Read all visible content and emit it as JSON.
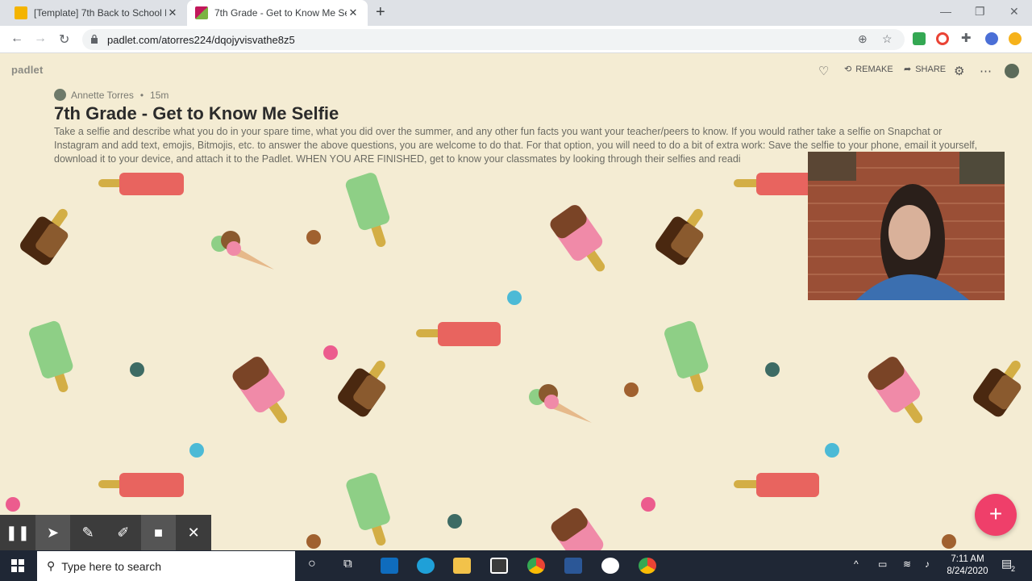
{
  "browser": {
    "tabs": [
      {
        "title": "[Template] 7th Back to School Le",
        "active": false,
        "favicon_color": "#f4b400"
      },
      {
        "title": "7th Grade - Get to Know Me Selfi",
        "active": true,
        "favicon_color": "#c2185b"
      }
    ],
    "url": "padlet.com/atorres224/dqojyvisvathe8z5"
  },
  "padlet": {
    "logo": "padlet",
    "remake_label": "REMAKE",
    "share_label": "SHARE",
    "author": "Annette Torres",
    "time_ago": "15m",
    "title": "7th Grade - Get to Know Me Selfie",
    "description": "Take a selfie and describe what you do in your spare time, what you did over the summer, and any other fun facts you want your teacher/peers to know. If you would rather take a selfie on Snapchat or Instagram and add text, emojis, Bitmojis, etc. to answer the above questions, you are welcome to do that. For that option, you will need to do a bit of extra work: Save the selfie to your phone, email it yourself, download it to your device, and attach it to the Padlet. WHEN YOU ARE FINISHED, get to know your classmates by looking through their selfies and readi",
    "fab_label": "+"
  },
  "taskbar": {
    "search_placeholder": "Type here to search",
    "time": "7:11 AM",
    "date": "8/24/2020",
    "notifications": "2"
  },
  "colors": {
    "background": "#f4ecd3",
    "accent": "#ef3f6a",
    "popsicle_red": "#e8645f",
    "popsicle_green": "#8ecf86",
    "chocolate": "#6a3a1e"
  }
}
